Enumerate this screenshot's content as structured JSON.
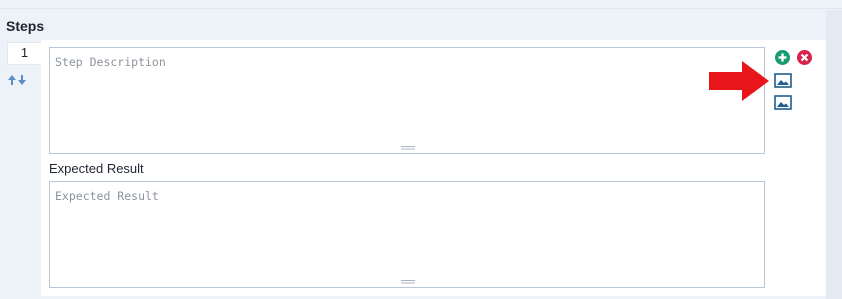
{
  "section": {
    "title": "Steps"
  },
  "step": {
    "number": "1",
    "description_placeholder": "Step Description",
    "expected_label": "Expected Result",
    "expected_placeholder": "Expected Result"
  },
  "icons": {
    "reorder": "reorder-arrows-icon",
    "add": "plus-circle-icon",
    "remove": "x-circle-icon",
    "image1": "image-icon",
    "image2": "image-icon",
    "annotation": "red-arrow-annotation"
  },
  "colors": {
    "add": "#169c6e",
    "remove": "#d8244a",
    "image": "#1f5e8e",
    "annotation": "#e8151b",
    "reorder": "#5b8fc6"
  }
}
